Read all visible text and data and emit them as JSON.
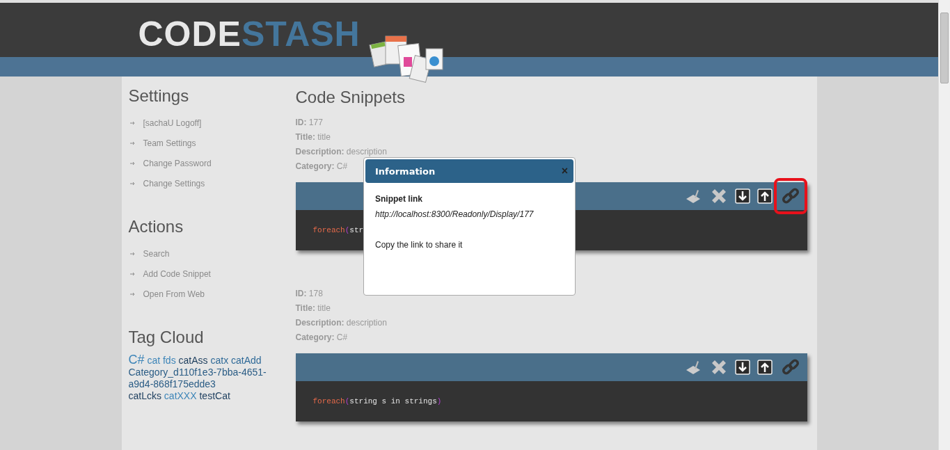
{
  "logo": {
    "part_1": "CODE",
    "part_2": "STASH"
  },
  "sidebar": {
    "sections": [
      {
        "title": "Settings",
        "items": [
          "[sachaU Logoff]",
          "Team Settings",
          "Change Password",
          "Change Settings"
        ]
      },
      {
        "title": "Actions",
        "items": [
          "Search",
          "Add Code Snippet",
          "Open From Web"
        ]
      }
    ],
    "tag_cloud": {
      "title": "Tag Cloud",
      "tags": [
        {
          "text": "C#",
          "kind": "large",
          "color": "#3d85b8"
        },
        {
          "text": "cat",
          "kind": "normal",
          "color": "#3d85b8"
        },
        {
          "text": "fds",
          "kind": "normal",
          "color": "#3d85b8"
        },
        {
          "text": "catAss",
          "kind": "normal",
          "color": "#1d3e5e"
        },
        {
          "text": "catx",
          "kind": "normal",
          "color": "#2f6a98"
        },
        {
          "text": "catAdd",
          "kind": "normal",
          "color": "#2f6a98"
        },
        {
          "text": "Category_d110f1e3-7bba-4651-a9d4-868f175edde3",
          "kind": "normal",
          "color": "#2a5c85"
        },
        {
          "text": "catLcks",
          "kind": "normal",
          "color": "#1d3e5e"
        },
        {
          "text": "catXXX",
          "kind": "normal",
          "color": "#3d85b8"
        },
        {
          "text": "testCat",
          "kind": "normal",
          "color": "#1d3e5e"
        }
      ]
    }
  },
  "main": {
    "title": "Code Snippets",
    "snippets": [
      {
        "fields": [
          {
            "label": "ID:",
            "value": "177"
          },
          {
            "label": "Title:",
            "value": "title"
          },
          {
            "label": "Description:",
            "value": "description"
          },
          {
            "label": "Category:",
            "value": "C#"
          }
        ],
        "link_highlighted": true,
        "code": [
          {
            "kind": "keyword",
            "text": "foreach"
          },
          {
            "kind": "paren",
            "text": "("
          },
          {
            "kind": "plain",
            "text": "str"
          }
        ]
      },
      {
        "fields": [
          {
            "label": "ID:",
            "value": "178"
          },
          {
            "label": "Title:",
            "value": "title"
          },
          {
            "label": "Description:",
            "value": "description"
          },
          {
            "label": "Category:",
            "value": "C#"
          }
        ],
        "link_highlighted": false,
        "code": [
          {
            "kind": "keyword",
            "text": "foreach"
          },
          {
            "kind": "paren",
            "text": "("
          },
          {
            "kind": "plain",
            "text": "string s in strings"
          },
          {
            "kind": "paren",
            "text": ")"
          }
        ]
      }
    ]
  },
  "dialog": {
    "title": "Information",
    "close": "×",
    "heading": "Snippet link",
    "link": "http://localhost:8300/Readonly/Display/177",
    "message": "Copy the link to share it"
  }
}
